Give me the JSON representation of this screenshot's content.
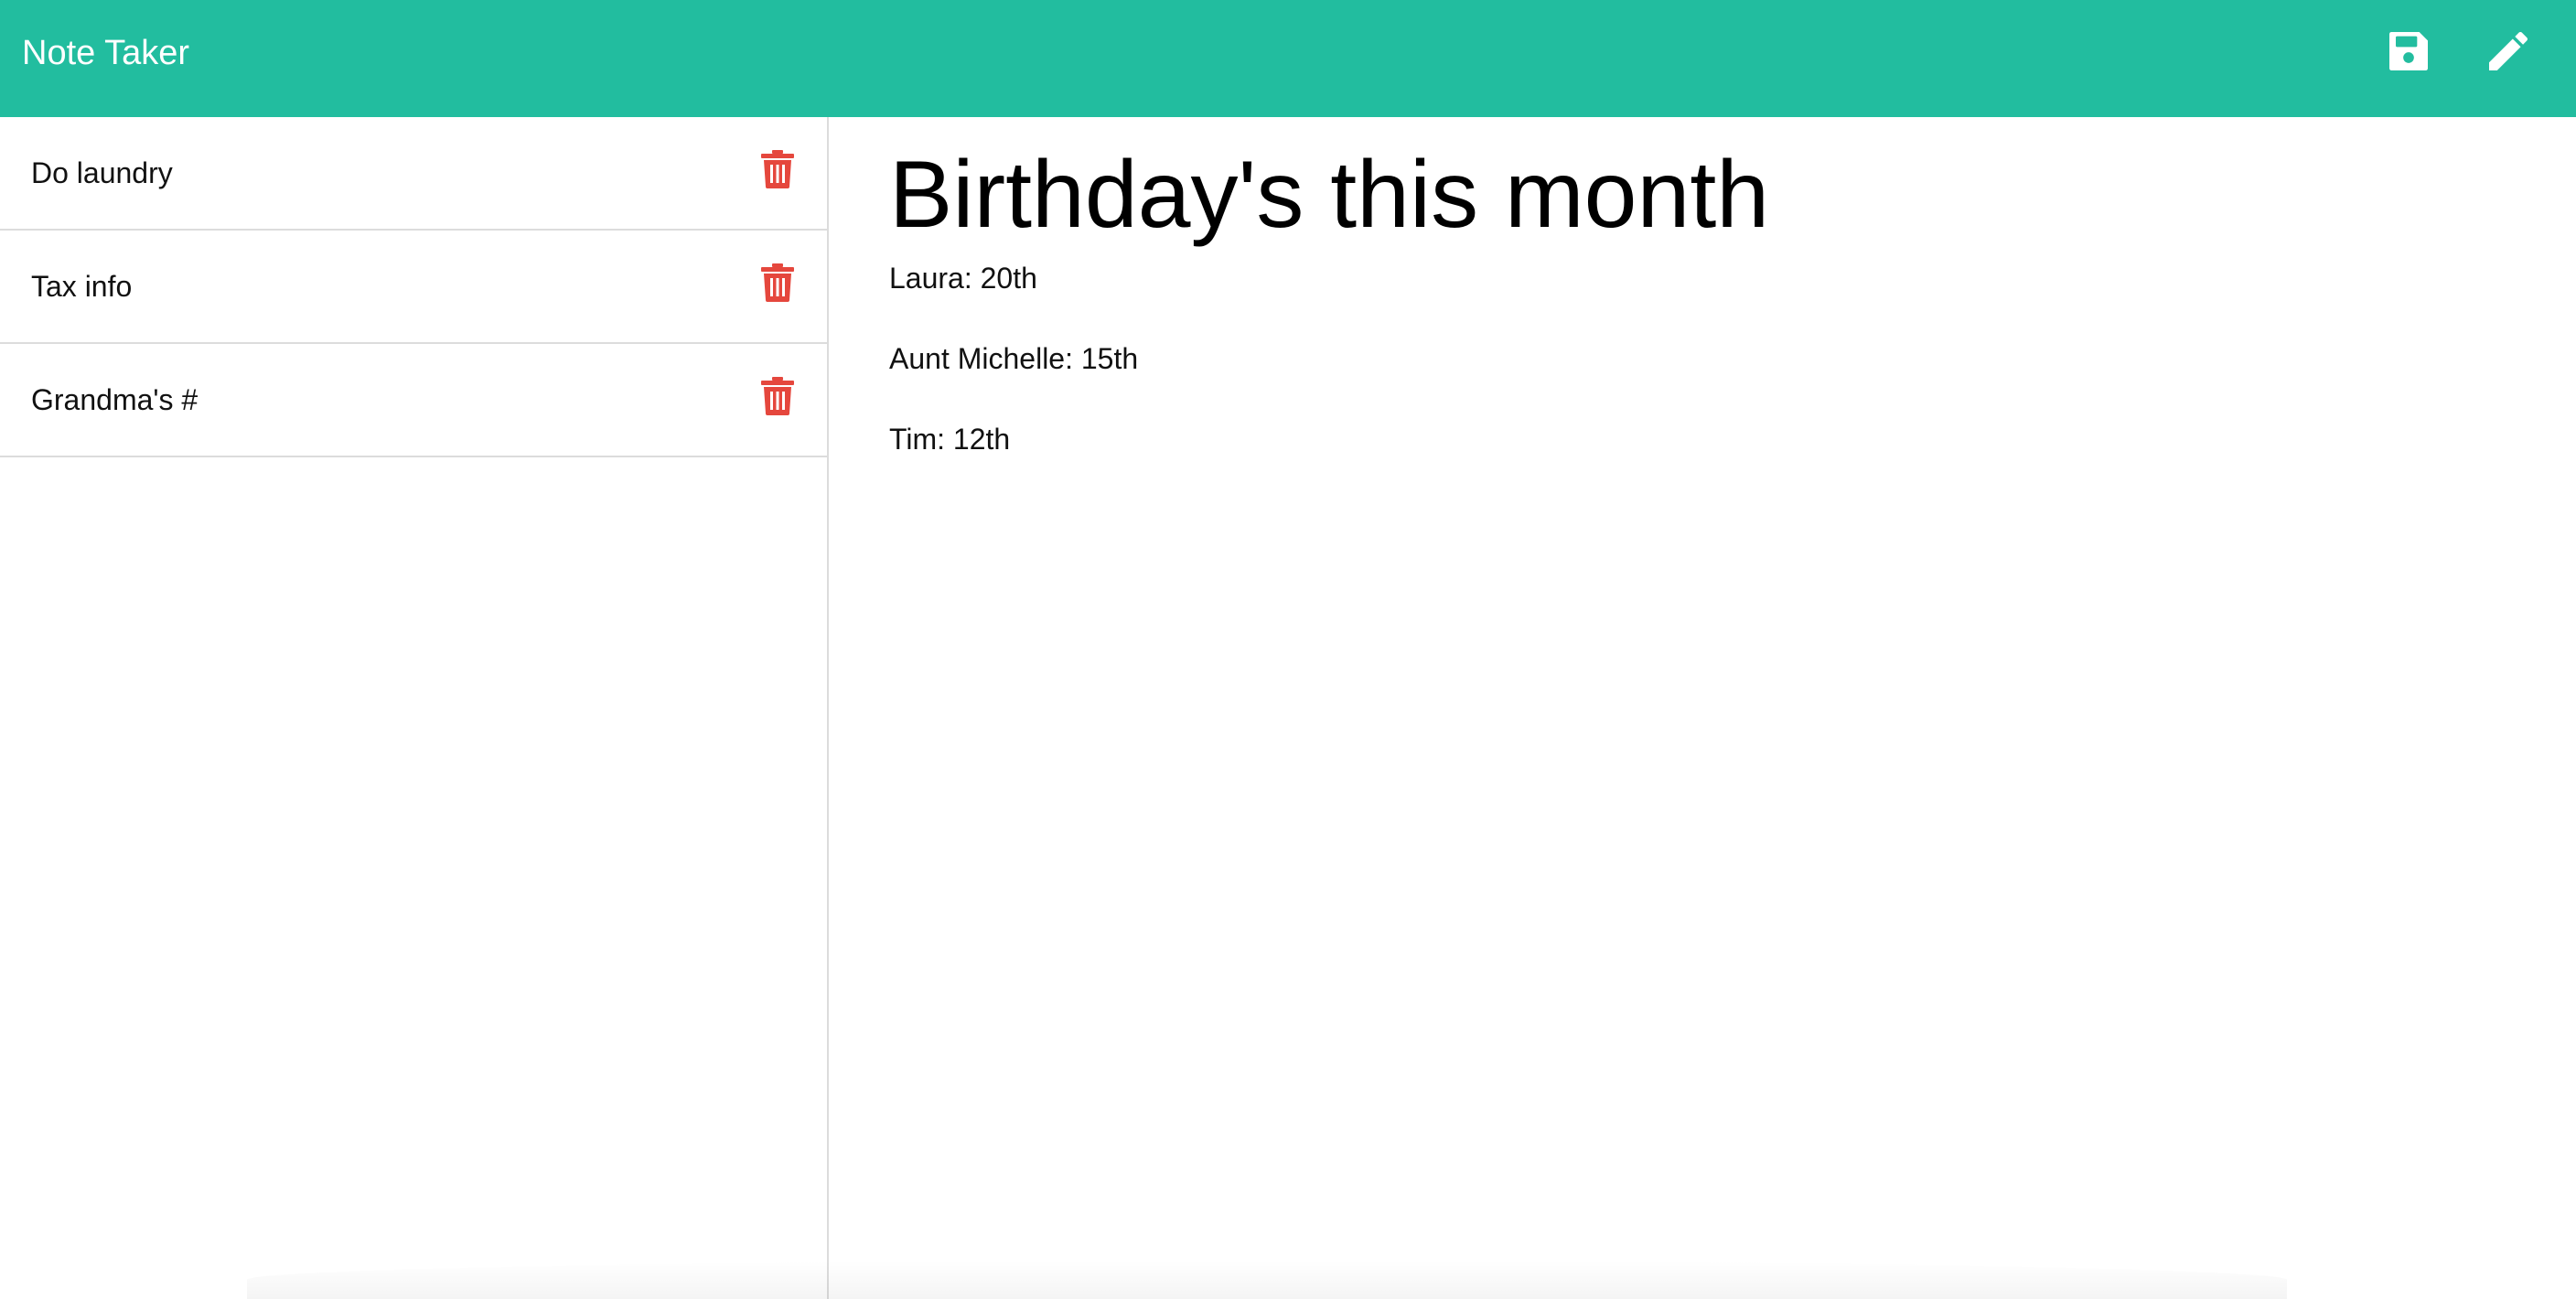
{
  "app": {
    "title": "Note Taker"
  },
  "toolbar": {
    "save_icon": "save-icon",
    "write_icon": "pencil-icon"
  },
  "notes": [
    {
      "title": "Do laundry",
      "delete_icon": "trash-icon"
    },
    {
      "title": "Tax info",
      "delete_icon": "trash-icon"
    },
    {
      "title": "Grandma's #",
      "delete_icon": "trash-icon"
    }
  ],
  "active_note": {
    "title": "Birthday's this month",
    "lines": [
      "Laura: 20th",
      "Aunt Michelle: 15th",
      "Tim: 12th"
    ]
  },
  "colors": {
    "navbar": "#22bd9f",
    "delete": "#e5473d",
    "text": "#111111"
  }
}
